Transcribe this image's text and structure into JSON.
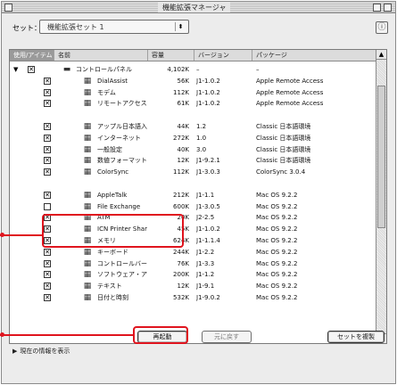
{
  "window": {
    "title": "機能拡張マネージャ"
  },
  "set": {
    "label": "セット：",
    "value": "機能拡張セット 1"
  },
  "columns": [
    "使用/アイテム",
    "名前",
    "容量",
    "バージョン",
    "パッケージ"
  ],
  "rows": [
    {
      "type": "folder",
      "checked": true,
      "name": "コントロールパネル",
      "size": "4,102K",
      "version": "–",
      "package": "–"
    },
    {
      "type": "item",
      "checked": true,
      "name": "DialAssist",
      "size": "56K",
      "version": "J1-1.0.2",
      "package": "Apple Remote Access"
    },
    {
      "type": "item",
      "checked": true,
      "name": "モデム",
      "size": "112K",
      "version": "J1-1.0.2",
      "package": "Apple Remote Access"
    },
    {
      "type": "item",
      "checked": true,
      "name": "リモートアクセス",
      "size": "61K",
      "version": "J1-1.0.2",
      "package": "Apple Remote Access"
    },
    {
      "type": "blank"
    },
    {
      "type": "item",
      "checked": true,
      "name": "アップル日本語入力プログラム",
      "size": "44K",
      "version": "1.2",
      "package": "Classic 日本語環境"
    },
    {
      "type": "item",
      "checked": true,
      "name": "インターネット",
      "size": "272K",
      "version": "1.0",
      "package": "Classic 日本語環境"
    },
    {
      "type": "item",
      "checked": true,
      "name": "一般設定",
      "size": "40K",
      "version": "3.0",
      "package": "Classic 日本語環境"
    },
    {
      "type": "item",
      "checked": true,
      "name": "数値フォーマット",
      "size": "12K",
      "version": "J1-9.2.1",
      "package": "Classic 日本語環境"
    },
    {
      "type": "item",
      "checked": true,
      "name": "ColorSync",
      "size": "112K",
      "version": "J1-3.0.3",
      "package": "ColorSync 3.0.4"
    },
    {
      "type": "blank"
    },
    {
      "type": "item",
      "checked": true,
      "name": "AppleTalk",
      "size": "212K",
      "version": "J1-1.1",
      "package": "Mac OS 9.2.2"
    },
    {
      "type": "item",
      "checked": false,
      "name": "File Exchange",
      "size": "600K",
      "version": "J1-3.0.5",
      "package": "Mac OS 9.2.2"
    },
    {
      "type": "item",
      "checked": true,
      "name": "ATM",
      "size": "20K",
      "version": "J2-2.5",
      "package": "Mac OS 9.2.2"
    },
    {
      "type": "item",
      "checked": true,
      "name": "ICN Printer Share",
      "size": "45K",
      "version": "J1-1.0.2",
      "package": "Mac OS 9.2.2"
    },
    {
      "type": "item",
      "checked": true,
      "name": "メモリ",
      "size": "624K",
      "version": "J1-1.1.4",
      "package": "Mac OS 9.2.2"
    },
    {
      "type": "item",
      "checked": true,
      "name": "キーボード",
      "size": "244K",
      "version": "J1-2.2",
      "package": "Mac OS 9.2.2"
    },
    {
      "type": "item",
      "checked": true,
      "name": "コントロールバー",
      "size": "76K",
      "version": "J1-3.3",
      "package": "Mac OS 9.2.2"
    },
    {
      "type": "item",
      "checked": true,
      "name": "ソフトウェア・アップデート",
      "size": "200K",
      "version": "J1-1.2",
      "package": "Mac OS 9.2.2"
    },
    {
      "type": "item",
      "checked": true,
      "name": "テキスト",
      "size": "12K",
      "version": "J1-9.1",
      "package": "Mac OS 9.2.2"
    },
    {
      "type": "item",
      "checked": true,
      "name": "日付と時刻",
      "size": "532K",
      "version": "J1-9.0.2",
      "package": "Mac OS 9.2.2"
    }
  ],
  "buttons": {
    "revert": "再起動",
    "undo": "元に戻す",
    "duplicate": "セットを複製"
  },
  "footer": {
    "toggle": "現在の情報を表示"
  },
  "colors": {
    "callout": "#e0141e"
  }
}
